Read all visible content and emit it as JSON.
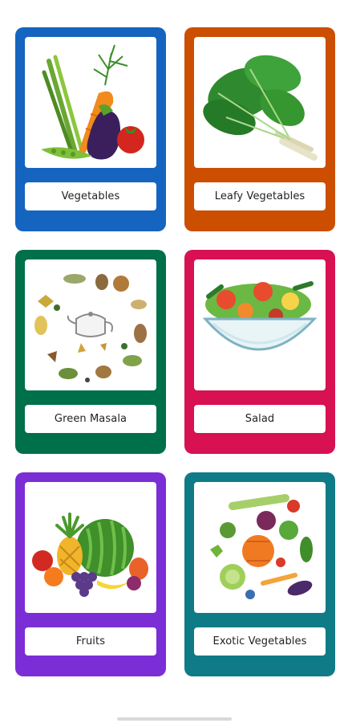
{
  "categories": [
    {
      "label": "Vegetables",
      "color": "#1565c0",
      "icon": "vegetables-illustration"
    },
    {
      "label": "Leafy Vegetables",
      "color": "#cc4e00",
      "icon": "leafy-greens-illustration"
    },
    {
      "label": "Green Masala",
      "color": "#00704a",
      "icon": "spices-illustration"
    },
    {
      "label": "Salad",
      "color": "#d81152",
      "icon": "salad-bowl-illustration"
    },
    {
      "label": "Fruits",
      "color": "#7b2ed6",
      "icon": "fruits-illustration"
    },
    {
      "label": "Exotic Vegetables",
      "color": "#0f7b86",
      "icon": "exotic-vegetables-illustration"
    }
  ]
}
